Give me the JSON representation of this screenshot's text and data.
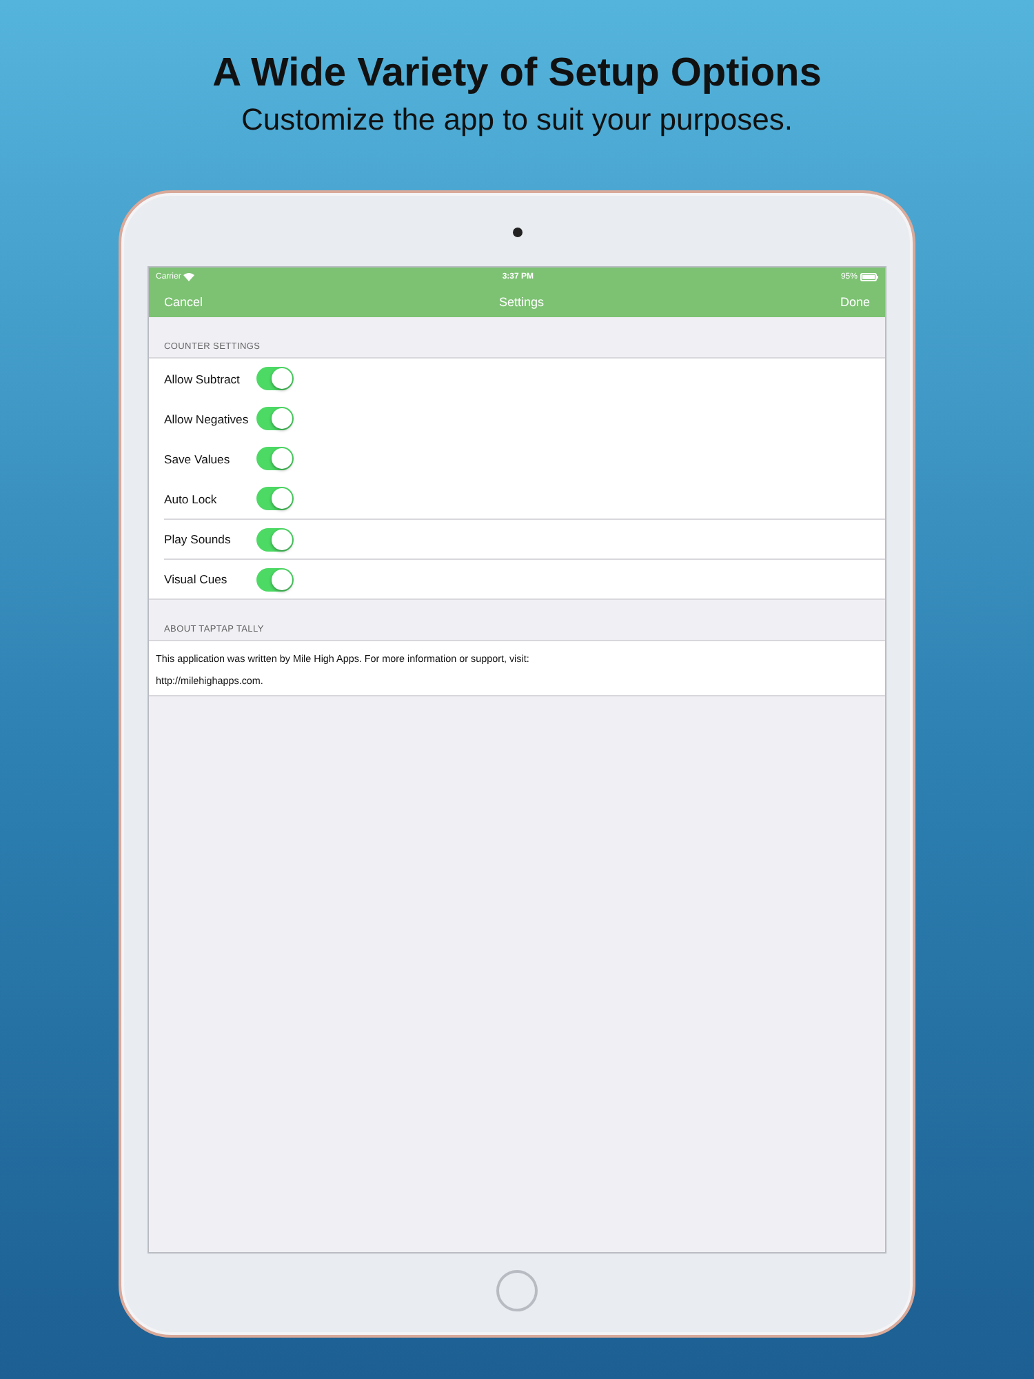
{
  "headline": "A Wide Variety of Setup Options",
  "subtitle": "Customize the app to suit your purposes.",
  "status_bar": {
    "carrier": "Carrier",
    "time": "3:37 PM",
    "battery": "95%"
  },
  "nav_bar": {
    "left": "Cancel",
    "title": "Settings",
    "right": "Done"
  },
  "sections": [
    {
      "header": "COUNTER SETTINGS",
      "kind": "toggles",
      "rows": [
        {
          "label": "Allow Subtract",
          "on": true,
          "separated": false
        },
        {
          "label": "Allow Negatives",
          "on": true,
          "separated": false
        },
        {
          "label": "Save Values",
          "on": true,
          "separated": false
        },
        {
          "label": "Auto Lock",
          "on": true,
          "separated": false
        },
        {
          "label": "Play Sounds",
          "on": true,
          "separated": true
        },
        {
          "label": "Visual Cues",
          "on": true,
          "separated": true
        }
      ]
    },
    {
      "header": "ABOUT TAPTAP TALLY",
      "kind": "text",
      "lines": [
        "This application was written by Mile High Apps.  For more information or support, visit:",
        "http://milehighapps.com."
      ]
    }
  ]
}
